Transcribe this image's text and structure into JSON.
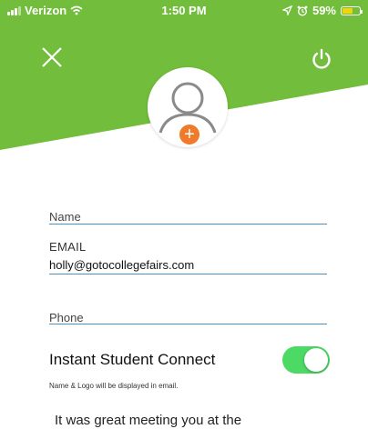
{
  "status_bar": {
    "carrier": "Verizon",
    "time": "1:50 PM",
    "battery": "59%",
    "battery_level": 0.59
  },
  "header": {
    "close_icon": "close-icon",
    "power_icon": "power-icon",
    "avatar_icon": "user-avatar-icon",
    "add_icon": "plus-icon",
    "add_symbol": "+"
  },
  "form": {
    "name_placeholder": "Name",
    "email_label": "EMAIL",
    "email_value": "holly@gotocollegefairs.com",
    "phone_placeholder": "Phone"
  },
  "connect": {
    "title": "Instant Student Connect",
    "enabled": true,
    "note": "Name & Logo will be displayed in email."
  },
  "message": {
    "text": "It was great meeting you at the"
  },
  "colors": {
    "header_green": "#72bd3c",
    "underline_blue": "#4a90c8",
    "toggle_green": "#4cd964",
    "add_orange": "#f07a2a"
  }
}
